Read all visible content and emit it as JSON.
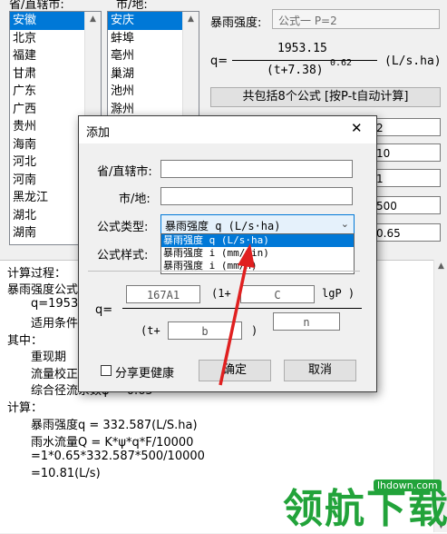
{
  "province_label": "省/直辖市:",
  "city_label": "市/地:",
  "provinces": [
    "安徽",
    "北京",
    "福建",
    "甘肃",
    "广东",
    "广西",
    "贵州",
    "海南",
    "河北",
    "河南",
    "黑龙江",
    "湖北",
    "湖南"
  ],
  "cities": [
    "安庆",
    "蚌埠",
    "亳州",
    "巢湖",
    "池州",
    "滁州"
  ],
  "intensity_label": "暴雨强度:",
  "formula_select": "公式一  P=2",
  "formula": {
    "q_prefix": "q=",
    "numerator": "1953.15",
    "denominator": "(t+7.38)",
    "exponent": "0.62",
    "unit": "(L/s.ha)"
  },
  "formula_count_button": "共包括8个公式 [按P-t自动计算]",
  "right_values": [
    "2",
    "10",
    "1",
    "500",
    "0.65"
  ],
  "log": {
    "process": "计算过程：",
    "intensity_formula": "暴雨强度公式",
    "q_value": "q=1953.",
    "condition": "适用条件",
    "where": "其中：",
    "return_period": "重现期",
    "flow_coef": "流量校正",
    "runoff": "综合径流系数ψ = 0.65",
    "calc": "计算：",
    "line1": "暴雨强度q = 332.587(L/S.ha)",
    "line2": "雨水流量Q = K*ψ*q*F/10000",
    "line3": "=1*0.65*332.587*500/10000",
    "line4": "=10.81(L/s)"
  },
  "dialog": {
    "title": "添加",
    "close": "✕",
    "province_label": "省/直辖市:",
    "city_label": "市/地:",
    "type_label": "公式类型:",
    "type_selected": "暴雨强度 q (L/s·ha)",
    "type_options": [
      "暴雨强度 q (L/s·ha)",
      "暴雨强度 i (mm/min)",
      "暴雨强度 i (mm/h)"
    ],
    "style_label": "公式样式:",
    "q_label": "q=",
    "field_a": "167A1",
    "one_plus": "(1+",
    "field_c": "C",
    "lgp": "lgP )",
    "t_plus": "(t+",
    "field_b": "b",
    "close_paren": ")",
    "field_n": "n",
    "share_checkbox": "分享更健康",
    "ok_button": "确定",
    "cancel_button": "取消"
  },
  "watermark": {
    "logo": "领航下载",
    "url": "lhdown.com"
  },
  "colors": {
    "selection": "#0078d7",
    "arrow": "#e02020",
    "watermark": "#22a33a"
  }
}
